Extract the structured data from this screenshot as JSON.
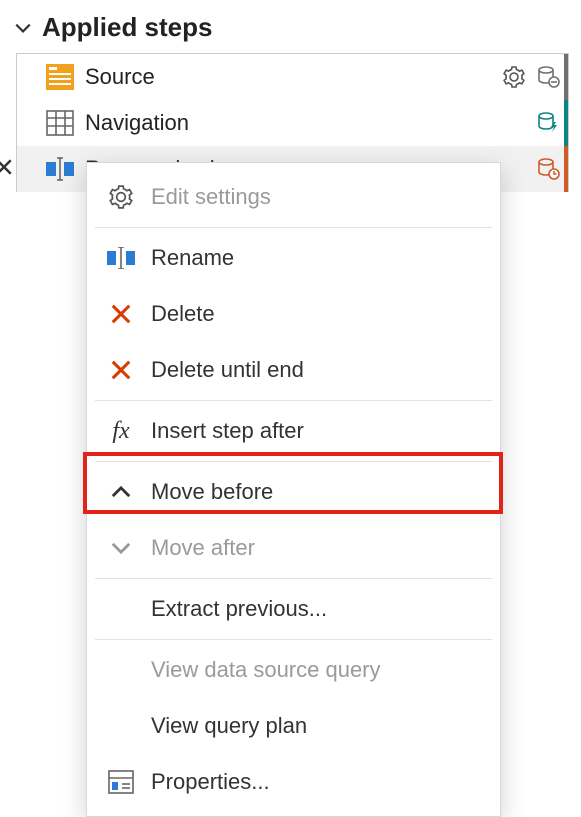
{
  "panel": {
    "title": "Applied steps"
  },
  "steps": [
    {
      "label": "Source",
      "icon": "data-source",
      "gear": true,
      "db_color": "#707070",
      "db_sub": "minus"
    },
    {
      "label": "Navigation",
      "icon": "table",
      "gear": false,
      "db_color": "#0d8484",
      "db_sub": "bolt"
    },
    {
      "label": "Renamed columns",
      "icon": "rename-col",
      "gear": false,
      "db_color": "#d05a2a",
      "db_sub": "clock",
      "selected": true
    }
  ],
  "menu": {
    "items": [
      {
        "id": "edit-settings",
        "label": "Edit settings",
        "icon": "gear",
        "disabled": true
      },
      {
        "sep": true
      },
      {
        "id": "rename",
        "label": "Rename",
        "icon": "rename-col"
      },
      {
        "id": "delete",
        "label": "Delete",
        "icon": "x-red"
      },
      {
        "id": "delete-until-end",
        "label": "Delete until end",
        "icon": "x-red"
      },
      {
        "sep": true
      },
      {
        "id": "insert-step-after",
        "label": "Insert step after",
        "icon": "fx"
      },
      {
        "sep": true
      },
      {
        "id": "move-before",
        "label": "Move before",
        "icon": "chev-up"
      },
      {
        "id": "move-after",
        "label": "Move after",
        "icon": "chev-down",
        "disabled": true
      },
      {
        "sep": true
      },
      {
        "id": "extract-previous",
        "label": "Extract previous...",
        "icon": ""
      },
      {
        "sep": true
      },
      {
        "id": "view-data-source-query",
        "label": "View data source query",
        "icon": "",
        "disabled": true
      },
      {
        "id": "view-query-plan",
        "label": "View query plan",
        "icon": ""
      },
      {
        "id": "properties",
        "label": "Properties...",
        "icon": "table-props"
      }
    ]
  }
}
